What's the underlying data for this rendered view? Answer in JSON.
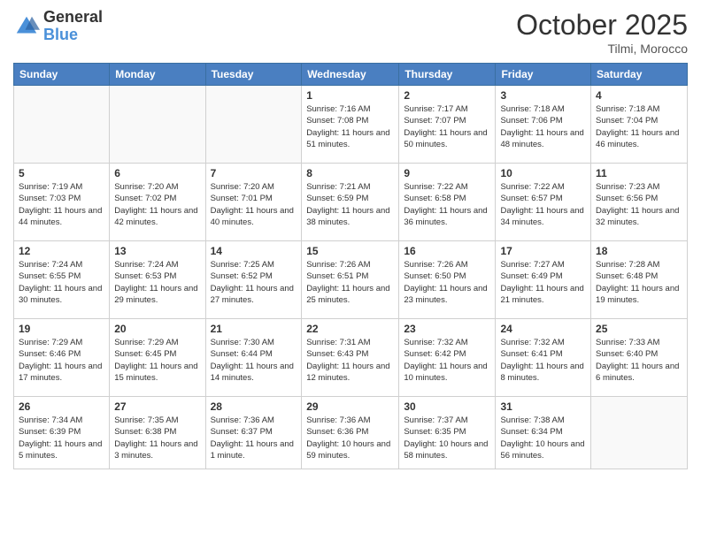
{
  "header": {
    "logo_general": "General",
    "logo_blue": "Blue",
    "month_title": "October 2025",
    "location": "Tilmi, Morocco"
  },
  "weekdays": [
    "Sunday",
    "Monday",
    "Tuesday",
    "Wednesday",
    "Thursday",
    "Friday",
    "Saturday"
  ],
  "weeks": [
    [
      {
        "day": "",
        "info": ""
      },
      {
        "day": "",
        "info": ""
      },
      {
        "day": "",
        "info": ""
      },
      {
        "day": "1",
        "info": "Sunrise: 7:16 AM\nSunset: 7:08 PM\nDaylight: 11 hours and 51 minutes."
      },
      {
        "day": "2",
        "info": "Sunrise: 7:17 AM\nSunset: 7:07 PM\nDaylight: 11 hours and 50 minutes."
      },
      {
        "day": "3",
        "info": "Sunrise: 7:18 AM\nSunset: 7:06 PM\nDaylight: 11 hours and 48 minutes."
      },
      {
        "day": "4",
        "info": "Sunrise: 7:18 AM\nSunset: 7:04 PM\nDaylight: 11 hours and 46 minutes."
      }
    ],
    [
      {
        "day": "5",
        "info": "Sunrise: 7:19 AM\nSunset: 7:03 PM\nDaylight: 11 hours and 44 minutes."
      },
      {
        "day": "6",
        "info": "Sunrise: 7:20 AM\nSunset: 7:02 PM\nDaylight: 11 hours and 42 minutes."
      },
      {
        "day": "7",
        "info": "Sunrise: 7:20 AM\nSunset: 7:01 PM\nDaylight: 11 hours and 40 minutes."
      },
      {
        "day": "8",
        "info": "Sunrise: 7:21 AM\nSunset: 6:59 PM\nDaylight: 11 hours and 38 minutes."
      },
      {
        "day": "9",
        "info": "Sunrise: 7:22 AM\nSunset: 6:58 PM\nDaylight: 11 hours and 36 minutes."
      },
      {
        "day": "10",
        "info": "Sunrise: 7:22 AM\nSunset: 6:57 PM\nDaylight: 11 hours and 34 minutes."
      },
      {
        "day": "11",
        "info": "Sunrise: 7:23 AM\nSunset: 6:56 PM\nDaylight: 11 hours and 32 minutes."
      }
    ],
    [
      {
        "day": "12",
        "info": "Sunrise: 7:24 AM\nSunset: 6:55 PM\nDaylight: 11 hours and 30 minutes."
      },
      {
        "day": "13",
        "info": "Sunrise: 7:24 AM\nSunset: 6:53 PM\nDaylight: 11 hours and 29 minutes."
      },
      {
        "day": "14",
        "info": "Sunrise: 7:25 AM\nSunset: 6:52 PM\nDaylight: 11 hours and 27 minutes."
      },
      {
        "day": "15",
        "info": "Sunrise: 7:26 AM\nSunset: 6:51 PM\nDaylight: 11 hours and 25 minutes."
      },
      {
        "day": "16",
        "info": "Sunrise: 7:26 AM\nSunset: 6:50 PM\nDaylight: 11 hours and 23 minutes."
      },
      {
        "day": "17",
        "info": "Sunrise: 7:27 AM\nSunset: 6:49 PM\nDaylight: 11 hours and 21 minutes."
      },
      {
        "day": "18",
        "info": "Sunrise: 7:28 AM\nSunset: 6:48 PM\nDaylight: 11 hours and 19 minutes."
      }
    ],
    [
      {
        "day": "19",
        "info": "Sunrise: 7:29 AM\nSunset: 6:46 PM\nDaylight: 11 hours and 17 minutes."
      },
      {
        "day": "20",
        "info": "Sunrise: 7:29 AM\nSunset: 6:45 PM\nDaylight: 11 hours and 15 minutes."
      },
      {
        "day": "21",
        "info": "Sunrise: 7:30 AM\nSunset: 6:44 PM\nDaylight: 11 hours and 14 minutes."
      },
      {
        "day": "22",
        "info": "Sunrise: 7:31 AM\nSunset: 6:43 PM\nDaylight: 11 hours and 12 minutes."
      },
      {
        "day": "23",
        "info": "Sunrise: 7:32 AM\nSunset: 6:42 PM\nDaylight: 11 hours and 10 minutes."
      },
      {
        "day": "24",
        "info": "Sunrise: 7:32 AM\nSunset: 6:41 PM\nDaylight: 11 hours and 8 minutes."
      },
      {
        "day": "25",
        "info": "Sunrise: 7:33 AM\nSunset: 6:40 PM\nDaylight: 11 hours and 6 minutes."
      }
    ],
    [
      {
        "day": "26",
        "info": "Sunrise: 7:34 AM\nSunset: 6:39 PM\nDaylight: 11 hours and 5 minutes."
      },
      {
        "day": "27",
        "info": "Sunrise: 7:35 AM\nSunset: 6:38 PM\nDaylight: 11 hours and 3 minutes."
      },
      {
        "day": "28",
        "info": "Sunrise: 7:36 AM\nSunset: 6:37 PM\nDaylight: 11 hours and 1 minute."
      },
      {
        "day": "29",
        "info": "Sunrise: 7:36 AM\nSunset: 6:36 PM\nDaylight: 10 hours and 59 minutes."
      },
      {
        "day": "30",
        "info": "Sunrise: 7:37 AM\nSunset: 6:35 PM\nDaylight: 10 hours and 58 minutes."
      },
      {
        "day": "31",
        "info": "Sunrise: 7:38 AM\nSunset: 6:34 PM\nDaylight: 10 hours and 56 minutes."
      },
      {
        "day": "",
        "info": ""
      }
    ]
  ]
}
